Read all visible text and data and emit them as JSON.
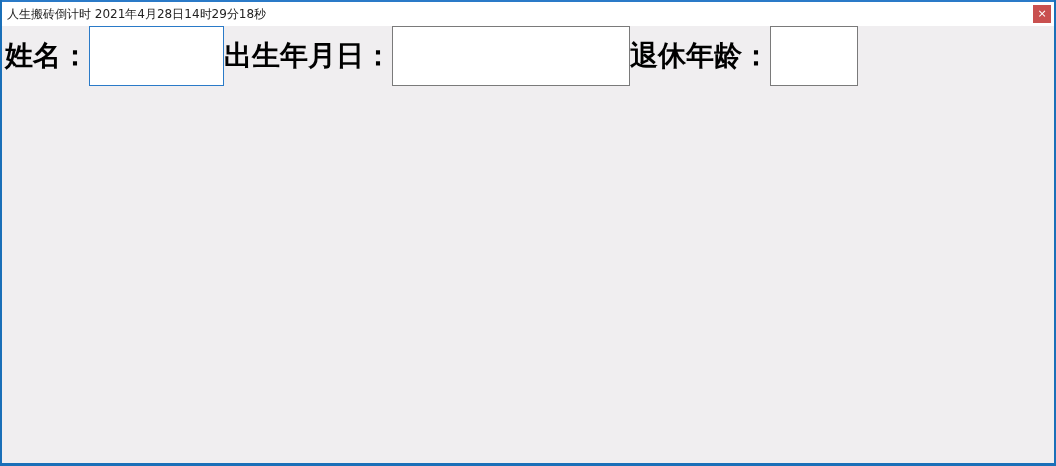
{
  "window": {
    "title": "人生搬砖倒计时 2021年4月28日14时29分18秒",
    "close": "×"
  },
  "fields": [
    {
      "label": "姓名：",
      "focused": true
    },
    {
      "label": "出生年月日：",
      "focused": false
    },
    {
      "label": "退休年龄：",
      "focused": false
    }
  ]
}
